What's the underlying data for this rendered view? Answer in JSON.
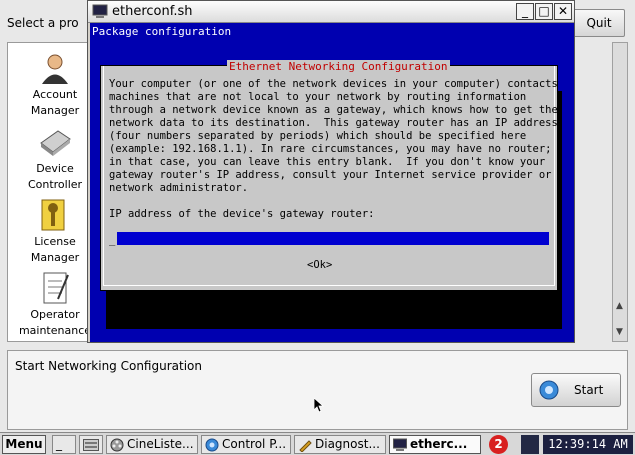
{
  "bg": {
    "header": "Select a pro",
    "quit_label": "Quit",
    "items": [
      {
        "line1": "Account",
        "line2": "Manager"
      },
      {
        "line1": "Device",
        "line2": "Controller"
      },
      {
        "line1": "License",
        "line2": "Manager"
      },
      {
        "line1": "Operator",
        "line2": "maintenance"
      }
    ],
    "status_text": "Start Networking Configuration",
    "start_label": "Start"
  },
  "window": {
    "title": "etherconf.sh",
    "minimize": "_",
    "maximize": "□",
    "close": "✕"
  },
  "term": {
    "header": "Package configuration",
    "dialog_title": "Ethernet Networking Configuration",
    "body": "Your computer (or one of the network devices in your computer) contacts\nmachines that are not local to your network by routing information\nthrough a network device known as a gateway, which knows how to get the\nnetwork data to its destination.  This gateway router has an IP address\n(four numbers separated by periods) which should be specified here\n(example: 192.168.1.1). In rare circumstances, you may have no router;\nin that case, you can leave this entry blank.  If you don't know your\ngateway router's IP address, consult your Internet service provider or\nnetwork administrator.",
    "field_label": "IP address of the device's gateway router:",
    "field_value": "",
    "field_prefix": "_",
    "ok_label": "<Ok>"
  },
  "taskbar": {
    "menu_label": "Menu",
    "items": [
      "_",
      "",
      "CineListe...",
      "Control P...",
      "Diagnost...",
      "etherc..."
    ],
    "badge": "2",
    "clock": "12:39:14 AM"
  }
}
